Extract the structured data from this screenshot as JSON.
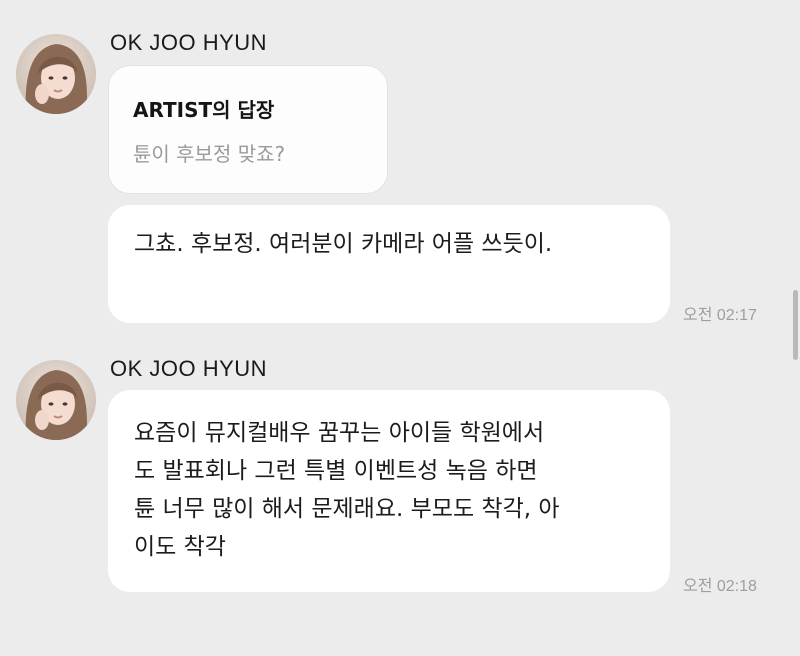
{
  "messages": [
    {
      "sender": "OK JOO HYUN",
      "reply": {
        "title": "ARTIST의 답장",
        "quoted": "튠이 후보정 맞죠?"
      },
      "text_lines": [
        "그쵸. 후보정. 여러분이 카메라 어플 쓰듯이."
      ],
      "time": "오전 02:17"
    },
    {
      "sender": "OK JOO HYUN",
      "text_lines": [
        "요즘이 뮤지컬배우 꿈꾸는 아이들 학원에서",
        "도 발표회나 그런 특별 이벤트성 녹음 하면",
        "튠 너무 많이 해서 문제래요. 부모도 착각, 아",
        "이도 착각"
      ],
      "time": "오전 02:18"
    }
  ],
  "colors": {
    "background": "#ececec",
    "bubble": "#ffffff",
    "timestamp": "#9e9e9e",
    "quoted_text": "#9a9a9a"
  },
  "icons": {
    "avatar": "profile-photo"
  }
}
